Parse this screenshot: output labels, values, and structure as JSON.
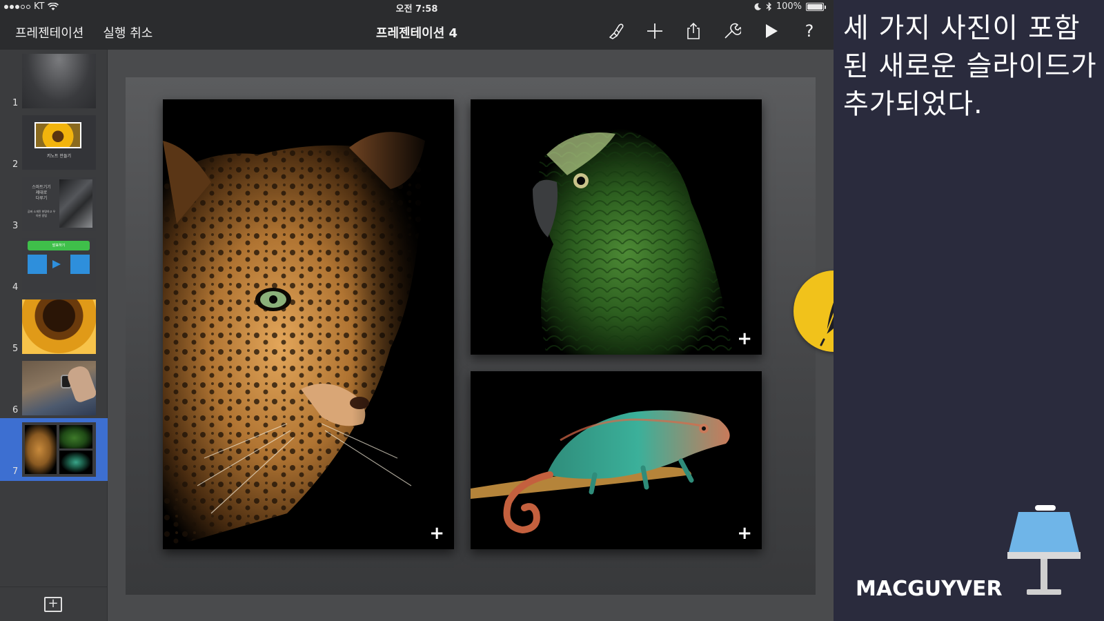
{
  "status_bar": {
    "carrier": "KT",
    "time": "오전 7:58",
    "battery": "100%"
  },
  "toolbar": {
    "presentations_label": "프레젠테이션",
    "undo_label": "실행 취소",
    "document_title": "프레젠테이션 4",
    "icons": [
      "paintbrush-icon",
      "add-icon",
      "share-icon",
      "wrench-icon",
      "play-icon",
      "help-icon"
    ],
    "help_label": "?"
  },
  "sidebar": {
    "slides": [
      {
        "number": "1"
      },
      {
        "number": "2",
        "caption": "키노트 만들기"
      },
      {
        "number": "3",
        "title_lines": [
          "스마트기기",
          "제대로",
          "다루기"
        ],
        "subtitle": "공짜 소개된 현명하고 우아한 방법"
      },
      {
        "number": "4",
        "banner": "발표하기"
      },
      {
        "number": "5"
      },
      {
        "number": "6"
      },
      {
        "number": "7",
        "selected": true
      }
    ],
    "add_slide_symbol": "+"
  },
  "slide": {
    "photos": [
      {
        "name": "leopard",
        "plus": "+"
      },
      {
        "name": "parrot",
        "plus": "+"
      },
      {
        "name": "chameleon",
        "plus": "+"
      }
    ]
  },
  "panel": {
    "caption_lines": [
      "세 가지 사진이 포함",
      "된 새로운 슬라이드가",
      "추가되었다."
    ],
    "brand": "MACGUYVER"
  },
  "colors": {
    "toolbar_bg": "#2b2c2e",
    "selection": "#3d6fd1",
    "panel_bg": "#2a2b3d",
    "badge": "#f1c21b",
    "keynote_blue": "#6fb5e8"
  }
}
